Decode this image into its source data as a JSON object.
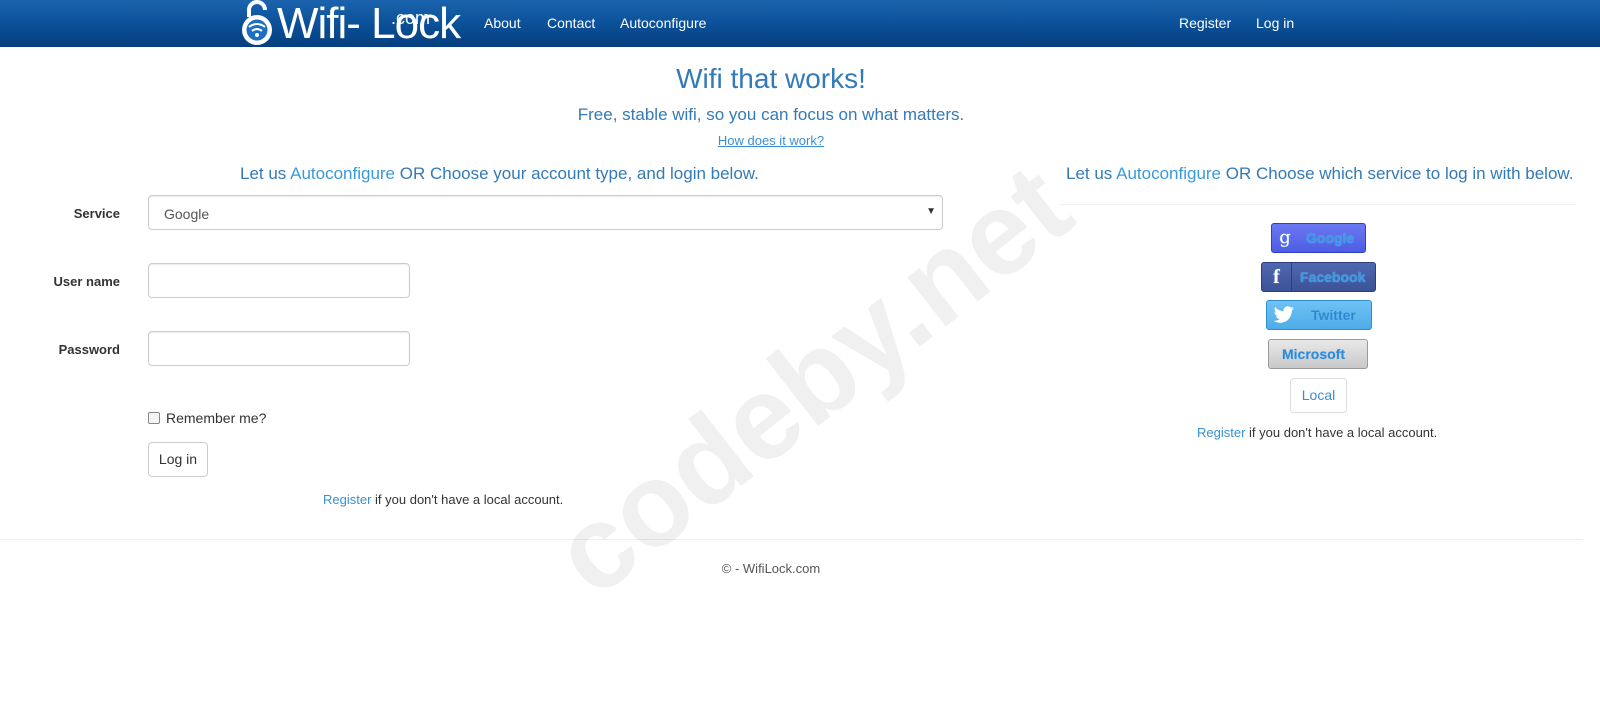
{
  "nav": {
    "logo_text": "Wifi- Lock",
    "logo_com": ".com",
    "links": {
      "about": "About",
      "contact": "Contact",
      "autoconfigure": "Autoconfigure",
      "register": "Register",
      "login": "Log in"
    },
    "background_color": "#0a4f97"
  },
  "hero": {
    "title": "Wifi that works!",
    "subtitle": "Free, stable wifi, so you can focus on what matters.",
    "how_link": "How does it work?"
  },
  "left": {
    "head_prefix": "Let us ",
    "head_link": "Autoconfigure",
    "head_suffix": " OR Choose your account type, and login below.",
    "service_label": "Service",
    "service_value": "Google",
    "username_label": "User name",
    "username_value": "",
    "password_label": "Password",
    "password_value": "",
    "remember_label": "Remember me?",
    "login_button": "Log in",
    "register_link": "Register",
    "register_suffix": " if you don't have a local account."
  },
  "right": {
    "head_prefix": "Let us ",
    "head_link": "Autoconfigure",
    "head_suffix": " OR Choose which service to log in with below.",
    "google": "Google",
    "facebook": "Facebook",
    "twitter": "Twitter",
    "microsoft": "Microsoft",
    "local": "Local",
    "register_link": "Register",
    "register_suffix": " if you don't have a local account."
  },
  "footer": {
    "text": "© - WifiLock.com"
  },
  "watermark": {
    "text": "codeby.net"
  },
  "colors": {
    "accent": "#337ab7",
    "link": "#3a8fd1"
  },
  "icons": {
    "logo": "lock-icon",
    "google": "google-icon",
    "facebook": "facebook-icon",
    "twitter": "twitter-bird-icon",
    "select": "dropdown-arrow-icon"
  }
}
